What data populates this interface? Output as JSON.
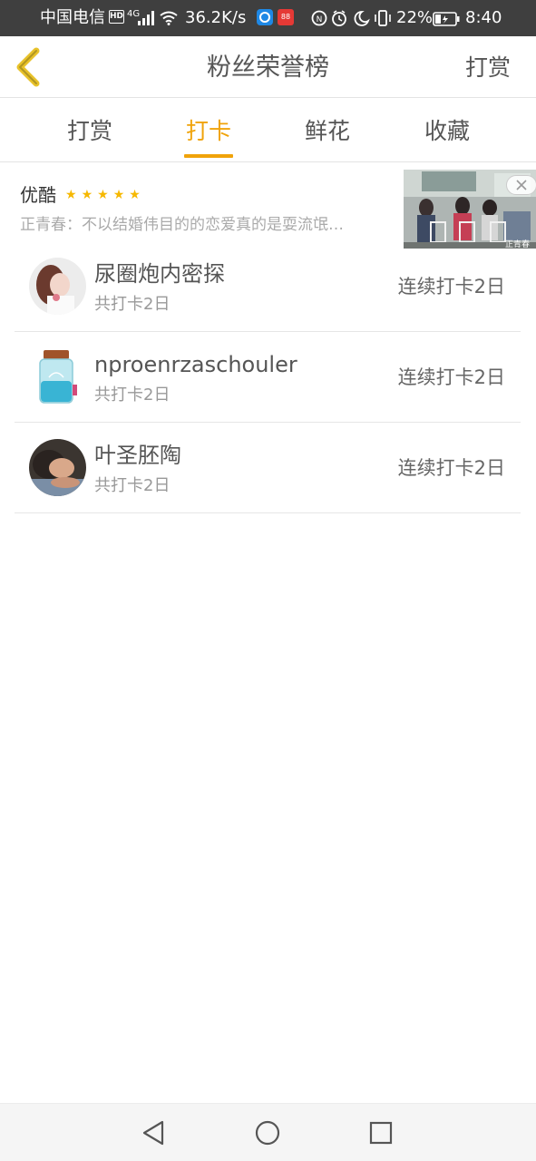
{
  "status_bar": {
    "carrier": "中国电信",
    "hd_badge": "HD",
    "network_type": "4G",
    "net_speed": "36.2K/s",
    "app2_badge": "88",
    "battery_percent": "22%",
    "time": "8:40"
  },
  "header": {
    "title": "粉丝荣誉榜",
    "action_label": "打赏",
    "back_icon": "chevron-left-icon"
  },
  "tabs": [
    {
      "label": "打赏",
      "active": false
    },
    {
      "label": "打卡",
      "active": true
    },
    {
      "label": "鲜花",
      "active": false
    },
    {
      "label": "收藏",
      "active": false
    }
  ],
  "ad": {
    "brand": "优酷",
    "rating_stars": 5,
    "description": "正青春：不以结婚伟目的的恋爱真的是耍流氓…",
    "image_caption": "正青春"
  },
  "list": [
    {
      "name": "尿圈炮内密探",
      "subtitle": "共打卡2日",
      "streak": "连续打卡2日"
    },
    {
      "name": "nproenrzaschouler",
      "subtitle": "共打卡2日",
      "streak": "连续打卡2日"
    },
    {
      "name": "叶圣胚陶",
      "subtitle": "共打卡2日",
      "streak": "连续打卡2日"
    }
  ],
  "colors": {
    "accent": "#f0a30a",
    "status_bar": "#3f3f3f",
    "text_primary": "#555555",
    "text_secondary": "#999999",
    "divider": "#e6e6e6"
  }
}
